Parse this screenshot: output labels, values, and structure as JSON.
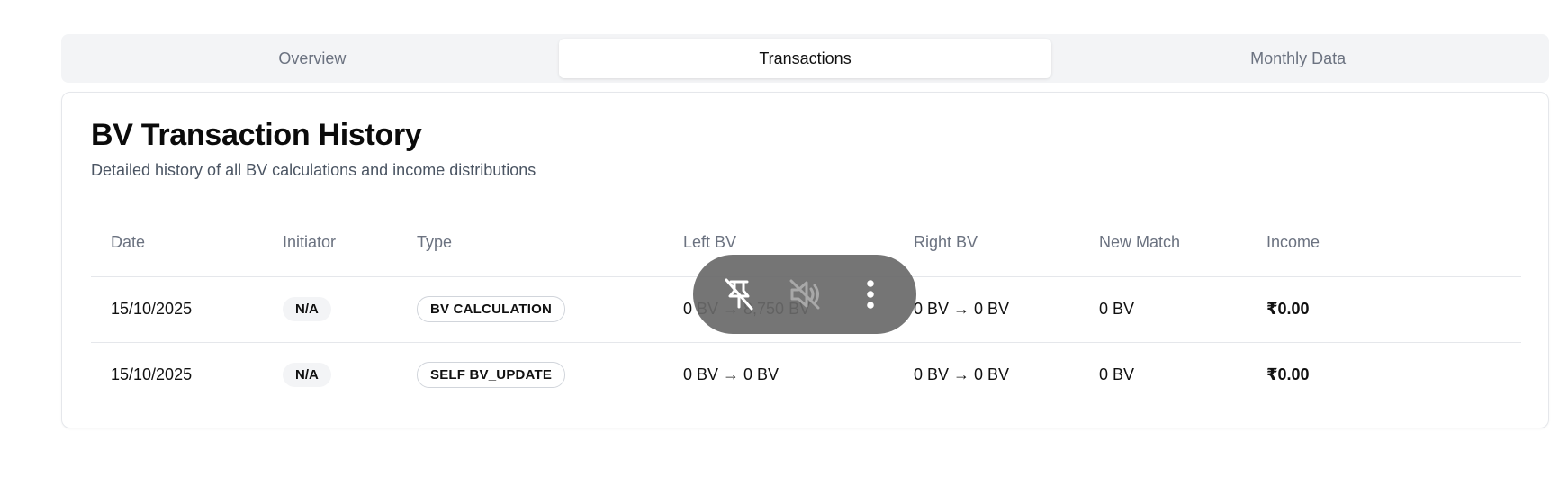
{
  "tabs": [
    {
      "label": "Overview",
      "active": false
    },
    {
      "label": "Transactions",
      "active": true
    },
    {
      "label": "Monthly Data",
      "active": false
    }
  ],
  "card": {
    "title": "BV Transaction History",
    "subtitle": "Detailed history of all BV calculations and income distributions"
  },
  "table": {
    "columns": [
      "Date",
      "Initiator",
      "Type",
      "Left BV",
      "Right BV",
      "New Match",
      "Income"
    ],
    "rows": [
      {
        "date": "15/10/2025",
        "initiator": "N/A",
        "type": "BV CALCULATION",
        "left_bv": "0 BV → 8,750 BV",
        "right_bv": "0 BV → 0 BV",
        "new_match": "0 BV",
        "income": "₹0.00"
      },
      {
        "date": "15/10/2025",
        "initiator": "N/A",
        "type": "SELF BV_UPDATE",
        "left_bv": "0 BV → 0 BV",
        "right_bv": "0 BV → 0 BV",
        "new_match": "0 BV",
        "income": "₹0.00"
      }
    ]
  },
  "overlay": {
    "icons": [
      "unpin-icon",
      "mute-icon",
      "more-vertical-icon"
    ]
  },
  "colors": {
    "new_match": "#22a04a",
    "income": "#2563eb",
    "tab_bar_bg": "#f3f4f6",
    "overlay_bg": "#696969"
  }
}
